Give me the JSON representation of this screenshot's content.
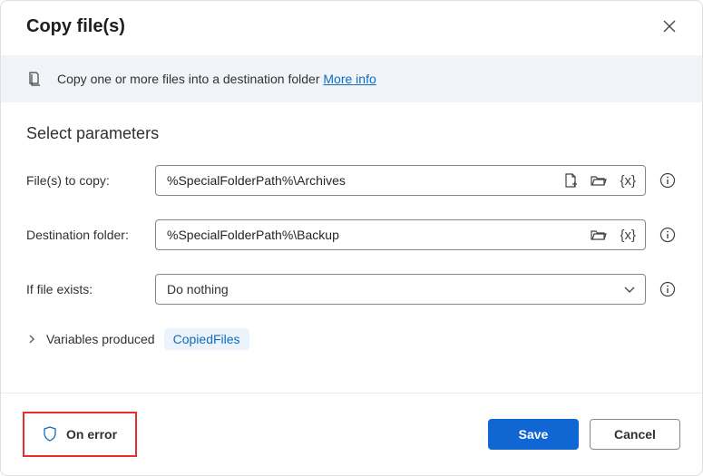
{
  "header": {
    "title": "Copy file(s)"
  },
  "banner": {
    "text": "Copy one or more files into a destination folder ",
    "link": "More info"
  },
  "section": {
    "title": "Select parameters"
  },
  "fields": {
    "files": {
      "label": "File(s) to copy:",
      "value": "%SpecialFolderPath%\\Archives"
    },
    "destination": {
      "label": "Destination folder:",
      "value": "%SpecialFolderPath%\\Backup"
    },
    "ifexists": {
      "label": "If file exists:",
      "value": "Do nothing"
    }
  },
  "vars": {
    "label": "Variables produced",
    "chip": "CopiedFiles"
  },
  "footer": {
    "onerror": "On error",
    "save": "Save",
    "cancel": "Cancel"
  },
  "iconTokens": {
    "vartoken": "{x}"
  }
}
